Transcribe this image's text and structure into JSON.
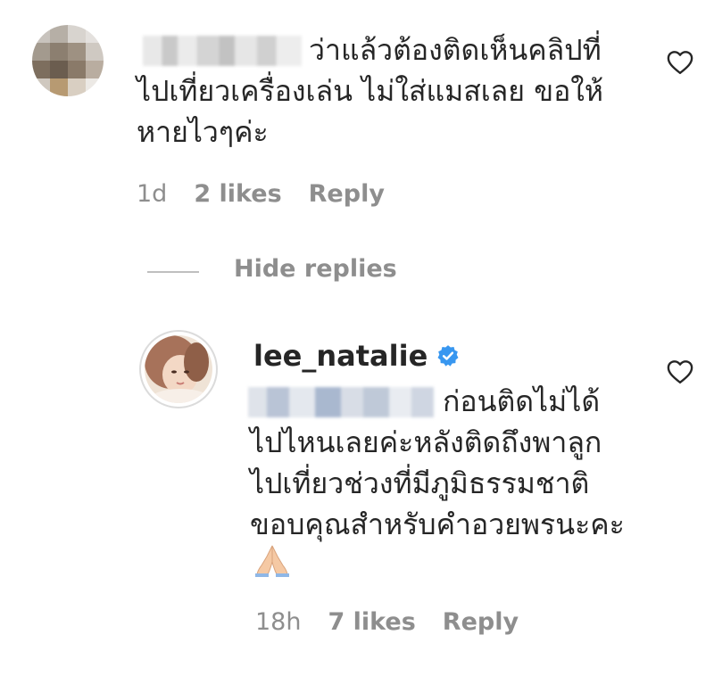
{
  "comment": {
    "text_line1": "ว่าแล้วต้องติดเห็นคลิปที่",
    "text_rest": "ไปเที่ยวเครื่องเล่น ไม่ใส่แมสเลย ขอให้\nหายไวๆค่ะ",
    "time": "1d",
    "likes": "2 likes",
    "reply_label": "Reply"
  },
  "hide_replies_label": "Hide replies",
  "reply": {
    "username": "lee_natalie",
    "text_line1": "ก่อนติดไม่ได้",
    "text_rest": "ไปไหนเลยค่ะหลังติดถึงพาลูก\nไปเที่ยวช่วงที่มีภูมิธรรมชาติ\nขอบคุณสำหรับคำอวยพรนะคะ",
    "time": "18h",
    "likes": "7 likes",
    "reply_label": "Reply"
  },
  "icons": {
    "like": "heart-outline-icon",
    "verified": "verified-badge-icon",
    "emoji": "folded-hands-emoji"
  },
  "colors": {
    "text": "#262626",
    "secondary": "#8e8e8e",
    "verified": "#3897f0"
  }
}
